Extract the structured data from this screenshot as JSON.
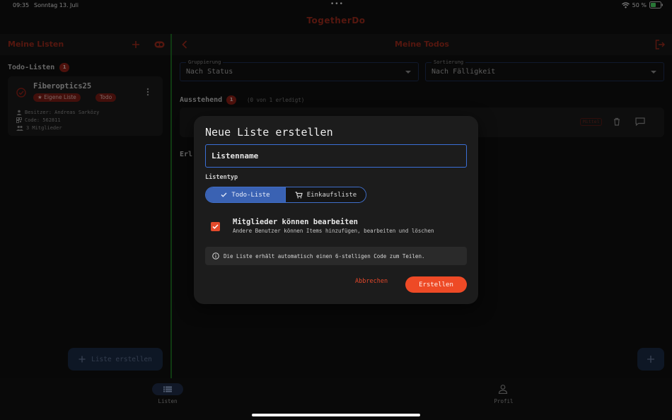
{
  "status_bar": {
    "time": "09:35",
    "date": "Sonntag 13. Juli",
    "battery": "50 %"
  },
  "app": {
    "title": "TogetherDo"
  },
  "sidebar": {
    "title": "Meine Listen",
    "section_title": "Todo-Listen",
    "section_count": "1",
    "list": {
      "name": "Fiberoptics25",
      "chip_own": "Eigene Liste",
      "chip_type": "Todo",
      "owner": "Besitzer: Andreas Sarközy",
      "code": "Code: 562811",
      "members": "3 Mitglieder"
    },
    "create_button": "Liste erstellen"
  },
  "main": {
    "title": "Meine Todos",
    "group": {
      "label": "Gruppierung",
      "value": "Nach Status"
    },
    "sort": {
      "label": "Sortierung",
      "value": "Nach Fälligkeit"
    },
    "pending": {
      "title": "Ausstehend",
      "count": "1",
      "sub": "(0 von 1 erledigt)"
    },
    "todo": {
      "priority": "Mittel"
    },
    "done_title": "Erl"
  },
  "bottom_nav": {
    "lists": "Listen",
    "profile": "Profil"
  },
  "dialog": {
    "title": "Neue Liste erstellen",
    "name_placeholder": "Listenname",
    "type_label": "Listentyp",
    "type_todo": "Todo-Liste",
    "type_shopping": "Einkaufsliste",
    "perm_title": "Mitglieder können bearbeiten",
    "perm_sub": "Andere Benutzer können Items hinzufügen, bearbeiten und löschen",
    "info": "Die Liste erhält automatisch einen 6-stelligen Code zum Teilen.",
    "cancel": "Abbrechen",
    "create": "Erstellen"
  },
  "colors": {
    "accent": "#ee4a26",
    "brand_dark": "#9c2a1c",
    "primary_blue": "#3a62b3",
    "divider_green": "#1d6b22"
  }
}
